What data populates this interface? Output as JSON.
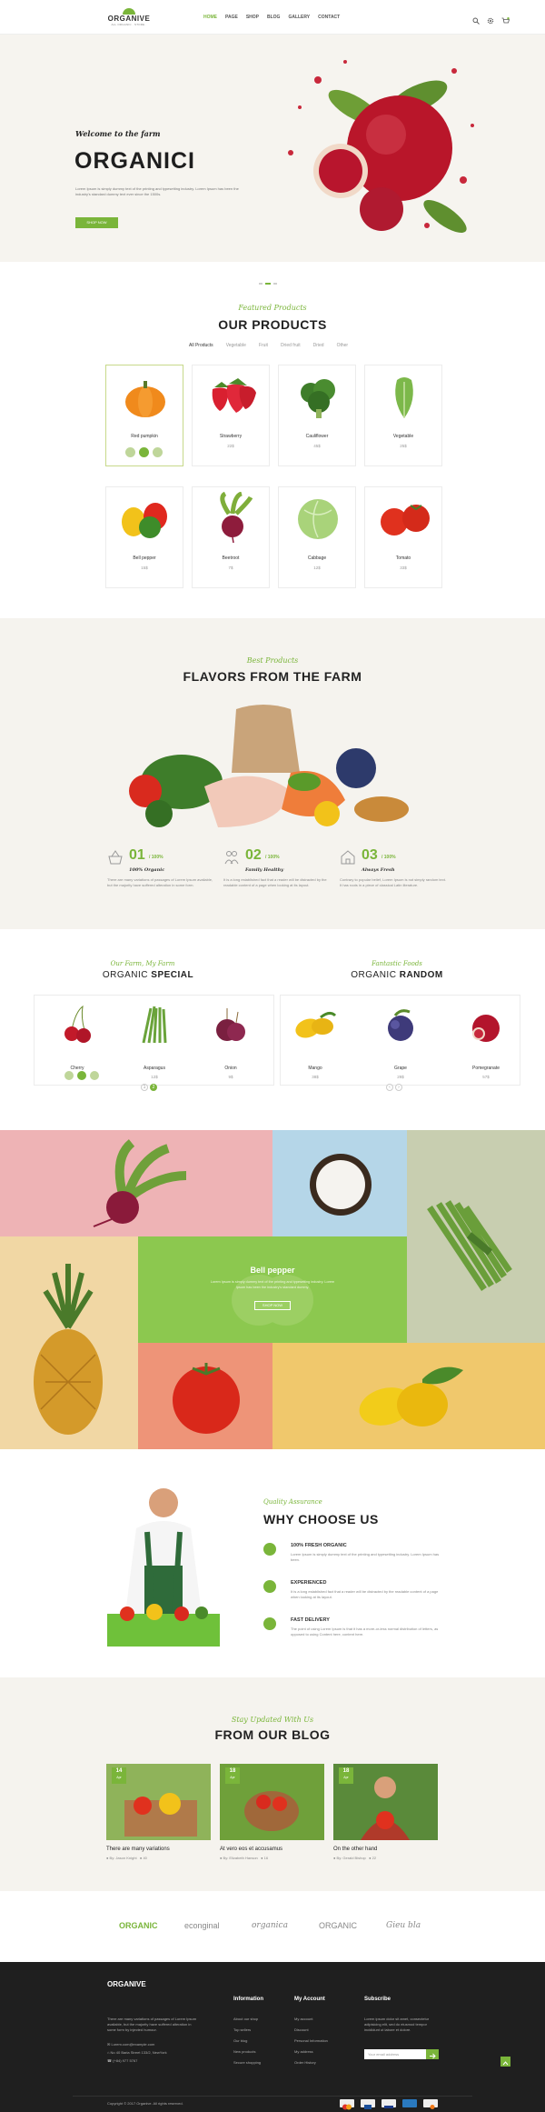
{
  "header": {
    "logo_name": "ORGANIVE",
    "logo_tag": "ALL ORGANIC · STORE ·",
    "nav": [
      "HOME",
      "PAGE",
      "SHOP",
      "BLOG",
      "GALLERY",
      "CONTACT"
    ],
    "active_nav": "HOME",
    "icons": [
      "search-icon",
      "gear-icon",
      "cart-icon"
    ]
  },
  "hero": {
    "welcome": "Welcome to the farm",
    "title": "ORGANICI",
    "desc": "Lorem Ipsum is simply dummy text of the printing and typesetting industry. Lorem Ipsum has been the industry's standard dummy text ever since the 1500s.",
    "button": "SHOP NOW"
  },
  "products": {
    "subtitle": "Featured Products",
    "title": "OUR PRODUCTS",
    "filters": [
      "All Products",
      "Vegetable",
      "Fruit",
      "Dried fruit",
      "Dried",
      "Other"
    ],
    "items": [
      {
        "name": "Red pumpkin",
        "price": ""
      },
      {
        "name": "Strawberry",
        "price": "22$"
      },
      {
        "name": "Cauliflower",
        "price": "45$"
      },
      {
        "name": "Vegetable",
        "price": "25$"
      },
      {
        "name": "Bell pepper",
        "price": "15$"
      },
      {
        "name": "Beetroot",
        "price": "7$"
      },
      {
        "name": "Cabbage",
        "price": "12$"
      },
      {
        "name": "Tomato",
        "price": "33$"
      }
    ]
  },
  "flavors": {
    "subtitle": "Best Products",
    "title": "FLAVORS FROM THE FARM",
    "features": [
      {
        "num": "01",
        "pct": "/ 100%",
        "caption": "100% Organic",
        "text": "There are many variations of passages of Lorem Ipsum available, but the majority have suffered alteration in some form."
      },
      {
        "num": "02",
        "pct": "/ 100%",
        "caption": "Family Healthy",
        "text": "It is a long established fact that a reader will be distracted by the readable content of a page when looking at its layout."
      },
      {
        "num": "03",
        "pct": "/ 100%",
        "caption": "Always Fresh",
        "text": "Contrary to popular belief, Lorem Ipsum is not simply random text. It has roots in a piece of classical Latin literature."
      }
    ]
  },
  "special": {
    "subtitle": "Our Farm, My Farm",
    "title_a": "ORGANIC ",
    "title_b": "SPECIAL",
    "items": [
      {
        "name": "Cherry",
        "price": ""
      },
      {
        "name": "Asparagus",
        "price": "12$"
      },
      {
        "name": "Onion",
        "price": "9$"
      }
    ],
    "pager": [
      "1",
      "2"
    ]
  },
  "random": {
    "subtitle": "Fantastic Foods",
    "title_a": "ORGANIC ",
    "title_b": "RANDOM",
    "items": [
      {
        "name": "Mango",
        "price": "38$"
      },
      {
        "name": "Grape",
        "price": "29$"
      },
      {
        "name": "Pomegranate",
        "price": "57$"
      }
    ]
  },
  "mosaic": {
    "center_title": "Bell pepper",
    "center_desc": "Lorem Ipsum is simply dummy text of the printing and typesetting industry. Lorem Ipsum has been the industry's standard dummy.",
    "center_button": "SHOP NOW"
  },
  "why": {
    "subtitle": "Quality Assurance",
    "title": "WHY CHOOSE US",
    "items": [
      {
        "title": "100% FRESH ORGANIC",
        "text": "Lorem Ipsum is simply dummy text of the printing and typesetting industry. Lorem Ipsum has been."
      },
      {
        "title": "EXPERIENCED",
        "text": "It is a long established fact that a reader will be distracted by the readable content of a page when looking at its layout."
      },
      {
        "title": "FAST DELIVERY",
        "text": "The point of using Lorem Ipsum is that it has a more-or-less normal distribution of letters, as opposed to using Content here, content here."
      }
    ]
  },
  "blog": {
    "subtitle": "Stay Updated With Us",
    "title": "FROM OUR BLOG",
    "posts": [
      {
        "day": "14",
        "month": "Apr",
        "title": "There are many variations",
        "author": "By: Jason Knight",
        "comments": "40"
      },
      {
        "day": "18",
        "month": "Apr",
        "title": "At vero eos et accusamus",
        "author": "By: Elizabeth Hanson",
        "comments": "16"
      },
      {
        "day": "18",
        "month": "Apr",
        "title": "On the other hand",
        "author": "By: Gerald Bishop",
        "comments": "22"
      }
    ]
  },
  "brands": [
    "ORGANIC",
    "econginal",
    "organica",
    "ORGANIC",
    "Gieu bla"
  ],
  "footer": {
    "logo_name": "ORGANIVE",
    "about": "There are many variations of passages of Lorem Ipsum available, but the majority have suffered alteration in some form by injected humour.",
    "email": "Lorem.com@example.com",
    "address": "No 40 Baria Street 133/2, NewYork",
    "phone": "(+84) 977 5767",
    "info_title": "Information",
    "info_links": [
      "About our shop",
      "Top sellers",
      "Our blog",
      "New products",
      "Secure shopping"
    ],
    "account_title": "My Account",
    "account_links": [
      "My account",
      "Discount",
      "Personal Information",
      "My address",
      "Order History"
    ],
    "sub_title": "Subscribe",
    "sub_desc": "Lorem ipsum dolor sit amet, consectetur adipisicing elit, sed do eiusmod tempor incididunt ut labore et dolore.",
    "sub_placeholder": "Your email address",
    "copyright": "Copyright © 2017 Organive. All rights reserved.",
    "payments": [
      "mastercard",
      "paypal",
      "visa",
      "amex",
      "discover"
    ]
  },
  "colors": {
    "accent": "#7ab53a",
    "hero_bg": "#f6f4ef",
    "footer_bg": "#1f1f1f"
  }
}
